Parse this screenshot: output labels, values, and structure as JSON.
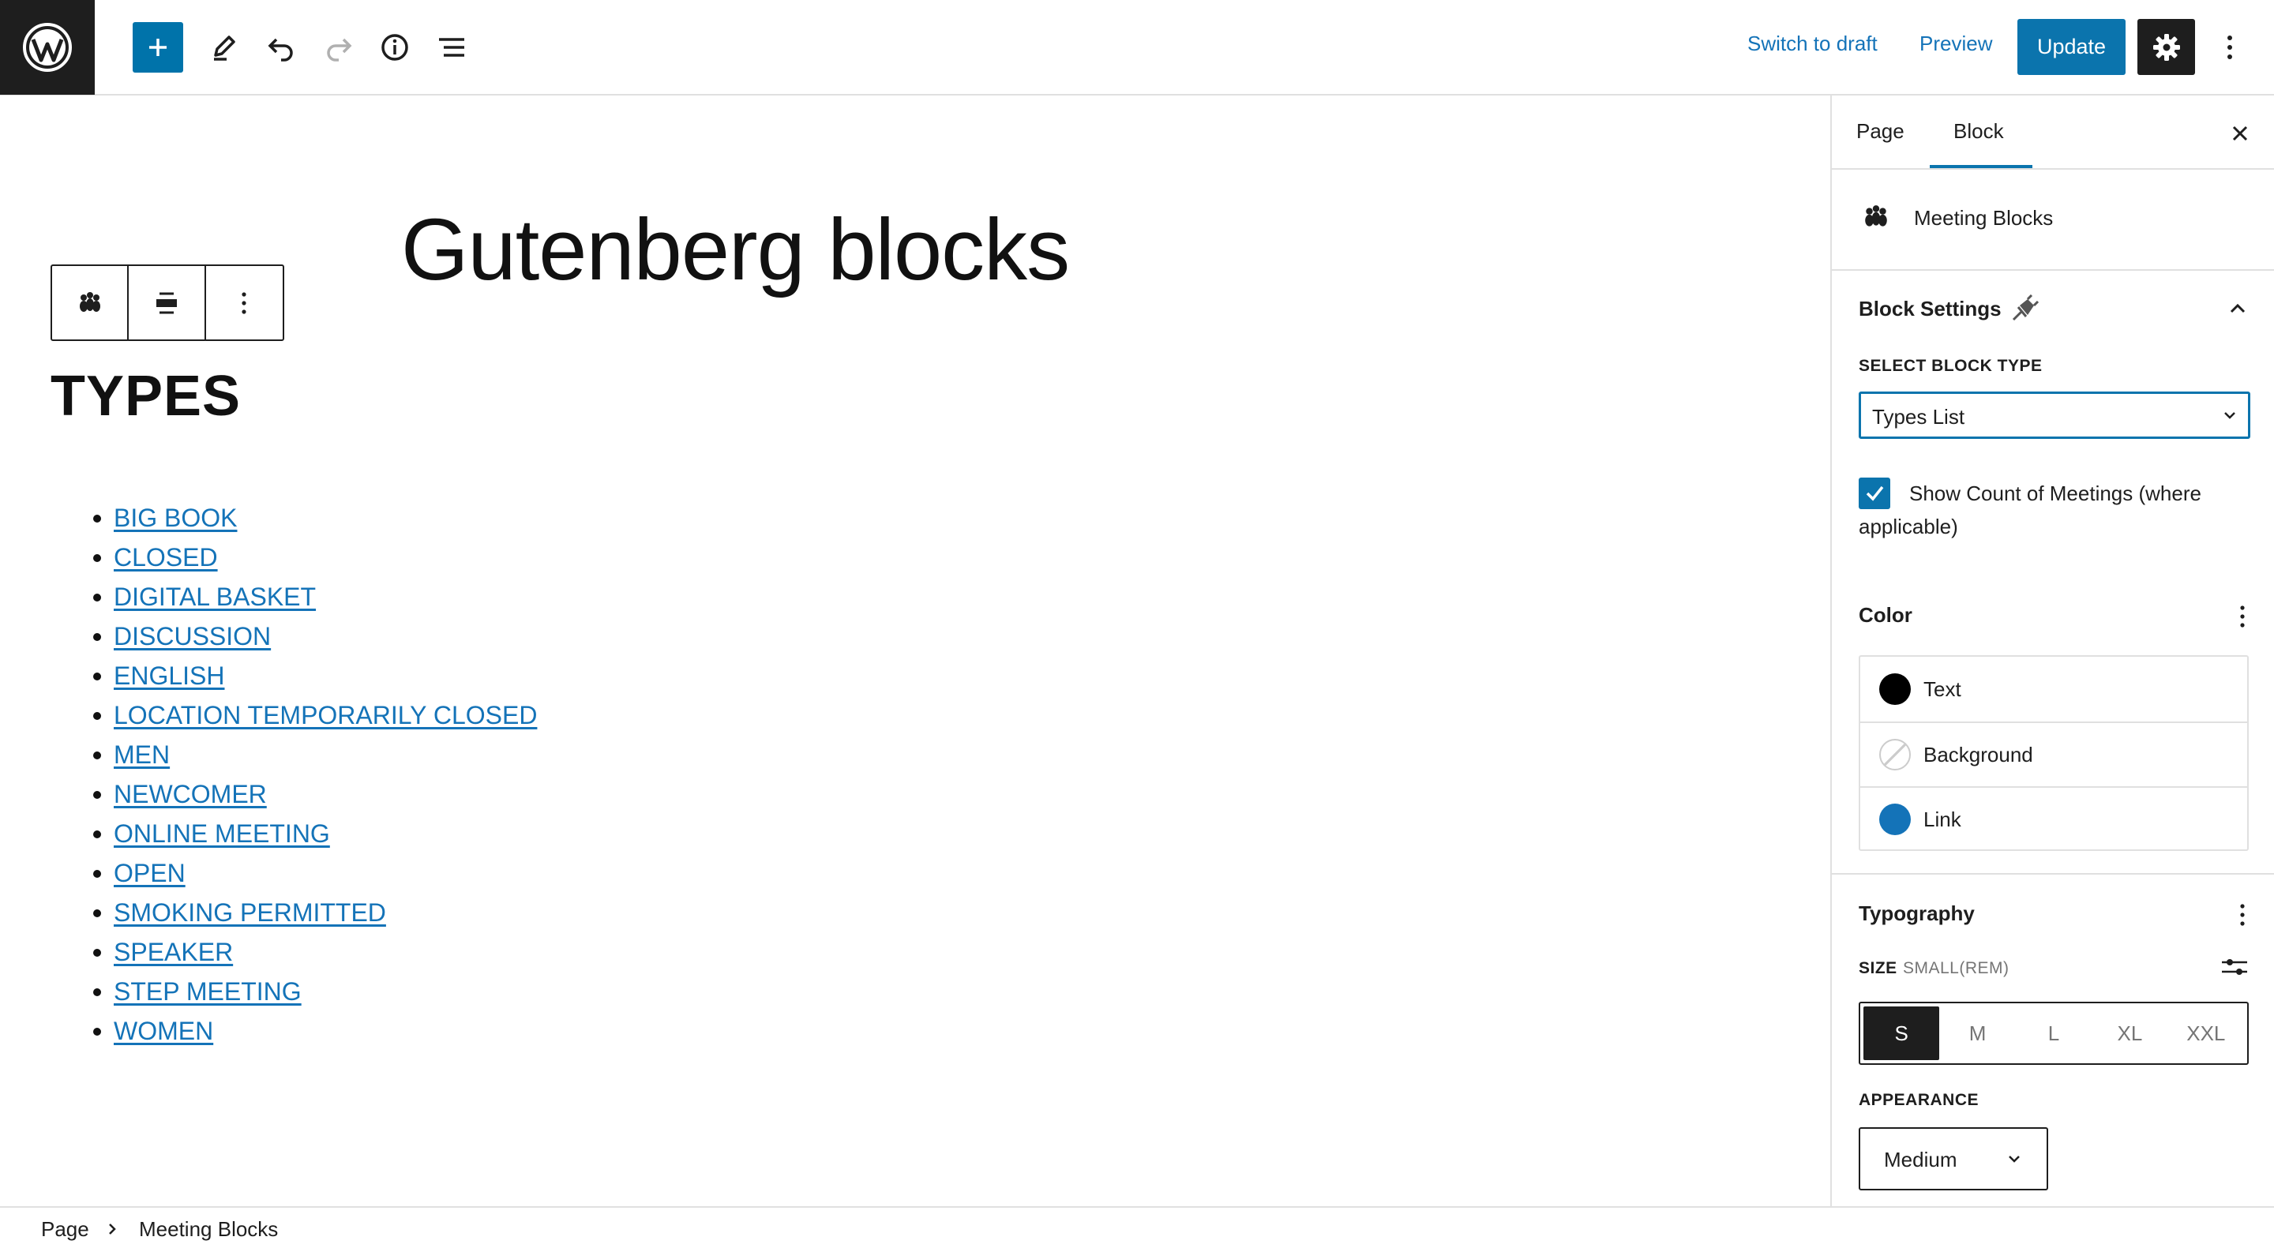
{
  "toolbar": {
    "switch_to_draft": "Switch to draft",
    "preview": "Preview",
    "update": "Update",
    "icons": [
      "wordpress-logo",
      "plus",
      "pencil",
      "undo",
      "redo",
      "info",
      "list-view",
      "gear",
      "more-vertical"
    ]
  },
  "canvas": {
    "page_title": "Gutenberg blocks",
    "block_toolbar_icons": [
      "meeting-blocks",
      "align",
      "more-vertical"
    ],
    "heading": "TYPES",
    "types": [
      "BIG BOOK",
      "CLOSED",
      "DIGITAL BASKET",
      "DISCUSSION",
      "ENGLISH",
      "LOCATION TEMPORARILY CLOSED",
      "MEN",
      "NEWCOMER",
      "ONLINE MEETING",
      "OPEN",
      "SMOKING PERMITTED",
      "SPEAKER",
      "STEP MEETING",
      "WOMEN"
    ]
  },
  "sidebar": {
    "tabs": {
      "page": "Page",
      "block": "Block",
      "active": "Block"
    },
    "block_card_title": "Meeting Blocks",
    "block_settings": {
      "title": "Block Settings",
      "select_label": "SELECT BLOCK TYPE",
      "select_value": "Types List",
      "checkbox_checked": true,
      "checkbox_label": "Show Count of Meetings (where applicable)"
    },
    "color": {
      "title": "Color",
      "items": [
        {
          "label": "Text",
          "color": "#000000"
        },
        {
          "label": "Background",
          "color": "transparent"
        },
        {
          "label": "Link",
          "color": "#1473b8"
        }
      ]
    },
    "typography": {
      "title": "Typography",
      "size_label": "SIZE",
      "size_hint": "SMALL(REM)",
      "sizes": [
        "S",
        "M",
        "L",
        "XL",
        "XXL"
      ],
      "active_size": "S",
      "appearance_label": "APPEARANCE",
      "appearance_value": "Medium"
    }
  },
  "breadcrumb": {
    "items": [
      "Page",
      "Meeting Blocks"
    ]
  },
  "colors": {
    "accent": "#0b74ad",
    "link": "#1473b8",
    "dark": "#1e1e1e",
    "border": "#e0e0e0"
  }
}
